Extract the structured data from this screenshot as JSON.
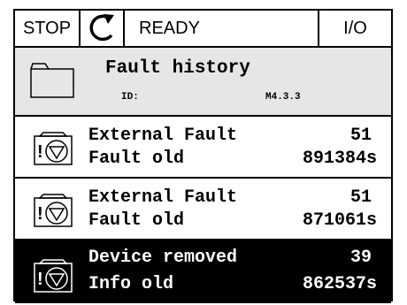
{
  "statusbar": {
    "stop": "STOP",
    "icon": "rotation-direction-icon",
    "state": "READY",
    "io": "I/O"
  },
  "header": {
    "icon": "folder-icon",
    "title": "Fault history",
    "id_label": "ID:",
    "id_value": "M4.3.3"
  },
  "faults": [
    {
      "name": "External Fault",
      "count": "51",
      "status": "Fault old",
      "time": "891384s",
      "icon": "fault-triangle-icon",
      "selected": false
    },
    {
      "name": "External Fault",
      "count": "51",
      "status": "Fault old",
      "time": "871061s",
      "icon": "fault-triangle-icon",
      "selected": false
    },
    {
      "name": "Device removed",
      "count": "39",
      "status": "Info old",
      "time": "862537s",
      "icon": "fault-triangle-icon",
      "selected": true
    }
  ],
  "colors": {
    "background": "#ffffff",
    "header_bg": "#e6e6e6",
    "selected_bg": "#000000",
    "text": "#000000",
    "selected_text": "#ffffff"
  }
}
